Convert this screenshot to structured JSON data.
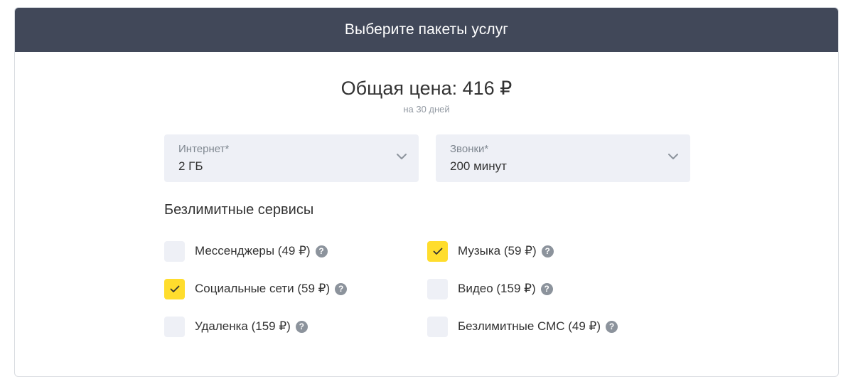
{
  "header": {
    "title": "Выберите пакеты услуг"
  },
  "price": {
    "title": "Общая цена: 416 ₽",
    "period": "на 30 дней"
  },
  "selects": [
    {
      "label": "Интернет*",
      "value": "2 ГБ",
      "icon": "chevron-down-icon"
    },
    {
      "label": "Звонки*",
      "value": "200 минут",
      "icon": "chevron-down-icon"
    }
  ],
  "services": {
    "title": "Безлимитные сервисы",
    "items": [
      {
        "label": "Мессенджеры (49 ₽)",
        "checked": false
      },
      {
        "label": "Музыка (59 ₽)",
        "checked": true
      },
      {
        "label": "Социальные сети (59 ₽)",
        "checked": true
      },
      {
        "label": "Видео (159 ₽)",
        "checked": false
      },
      {
        "label": "Удаленка (159 ₽)",
        "checked": false
      },
      {
        "label": "Безлимитные СМС (49 ₽)",
        "checked": false
      }
    ],
    "help_glyph": "?"
  },
  "colors": {
    "header_bg": "#414859",
    "checkbox_checked": "#ffdd2d",
    "checkbox_unchecked": "#eef0f6",
    "select_bg": "#eef0f6"
  }
}
